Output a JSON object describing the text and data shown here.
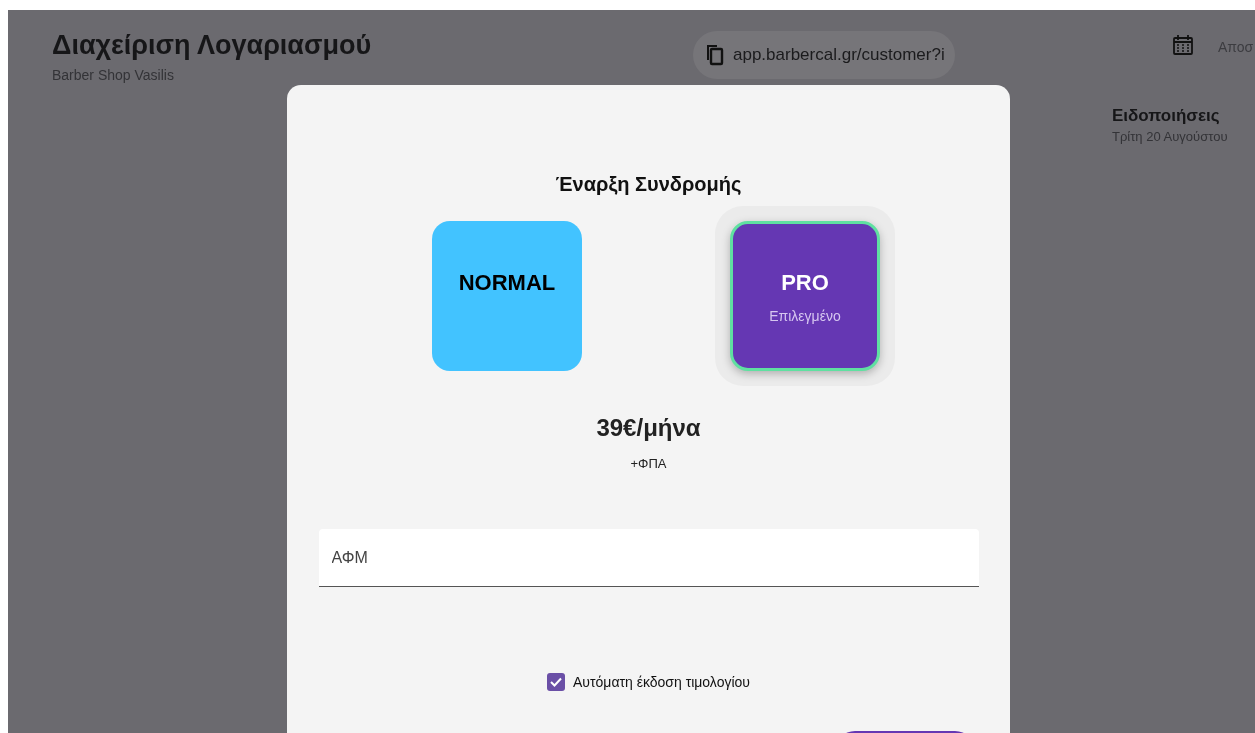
{
  "header": {
    "title": "Διαχείριση Λογαριασμού",
    "subtitle": "Barber Shop Vasilis",
    "link": "app.barbercal.gr/customer?i",
    "nav_label": "Αποσ"
  },
  "notifications": {
    "title": "Ειδοποιήσεις",
    "date": "Τρίτη 20 Αυγούστου"
  },
  "dialog": {
    "title": "Έναρξη Συνδρομής",
    "plans": [
      {
        "name": "NORMAL",
        "selected": false,
        "color": "#42c3ff"
      },
      {
        "name": "PRO",
        "note": "Επιλεγμένο",
        "selected": true,
        "color": "#6537b3"
      }
    ],
    "price": "39€/μήνα",
    "tax_note": "+ΦΠΑ",
    "vat_field": {
      "placeholder": "ΑΦΜ"
    },
    "auto_invoice": {
      "label": "Αυτόματη έκδοση τιμολογίου",
      "checked": true
    }
  }
}
